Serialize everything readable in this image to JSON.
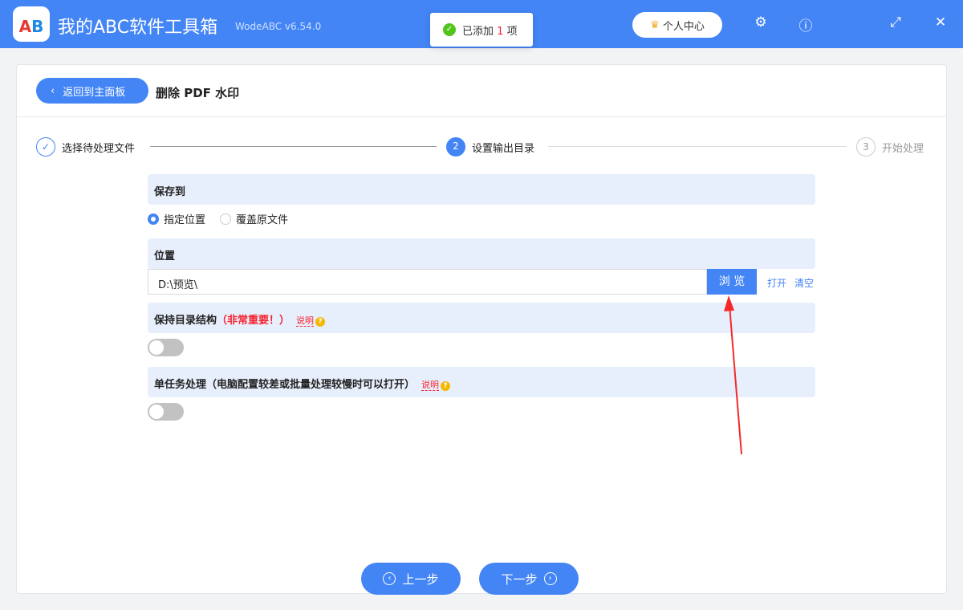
{
  "app": {
    "title": "我的ABC软件工具箱",
    "version": "WodeABC v6.54.0",
    "logo": "AB",
    "user_center": "个人中心"
  },
  "toast": {
    "prefix": "已添加",
    "count": "1",
    "suffix": "项"
  },
  "header": {
    "back": "返回到主面板",
    "title": "删除 PDF 水印"
  },
  "steps": [
    {
      "num": "✓",
      "label": "选择待处理文件"
    },
    {
      "num": "2",
      "label": "设置输出目录"
    },
    {
      "num": "3",
      "label": "开始处理"
    }
  ],
  "save": {
    "title": "保存到",
    "options": [
      "指定位置",
      "覆盖原文件"
    ]
  },
  "location": {
    "title": "位置",
    "value": "D:\\预览\\",
    "browse": "浏 览",
    "open": "打开",
    "clear": "清空"
  },
  "keep_dir": {
    "title": "保持目录结构",
    "warn": "（非常重要！）",
    "note": "说明"
  },
  "single": {
    "title": "单任务处理（电脑配置较差或批量处理较慢时可以打开）",
    "note": "说明"
  },
  "footer": {
    "prev": "上一步",
    "next": "下一步"
  }
}
